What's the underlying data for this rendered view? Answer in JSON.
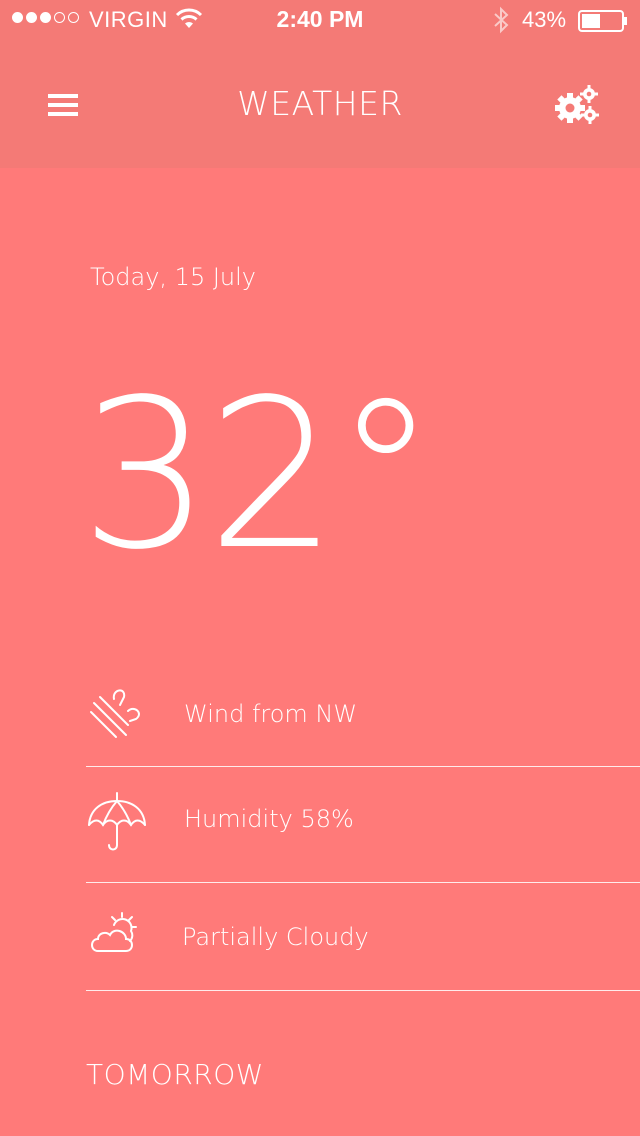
{
  "status_bar": {
    "carrier": "VIRGIN",
    "time": "2:40 PM",
    "battery": "43%",
    "signal_bars": 3,
    "signal_max": 5
  },
  "nav": {
    "title": "WEATHER",
    "menu_icon": "hamburger-menu-icon",
    "settings_icon": "gears-icon"
  },
  "today": {
    "date": "Today, 15 July",
    "temperature": "32°"
  },
  "details": [
    {
      "icon": "wind-icon",
      "label": "Wind from NW"
    },
    {
      "icon": "umbrella-icon",
      "label": "Humidity 58%"
    },
    {
      "icon": "partly-cloudy-icon",
      "label": "Partially Cloudy"
    }
  ],
  "tomorrow_label": "TOMORROW",
  "colors": {
    "background": "#ff7a79",
    "header": "#f47a76",
    "text": "#ffffff"
  }
}
